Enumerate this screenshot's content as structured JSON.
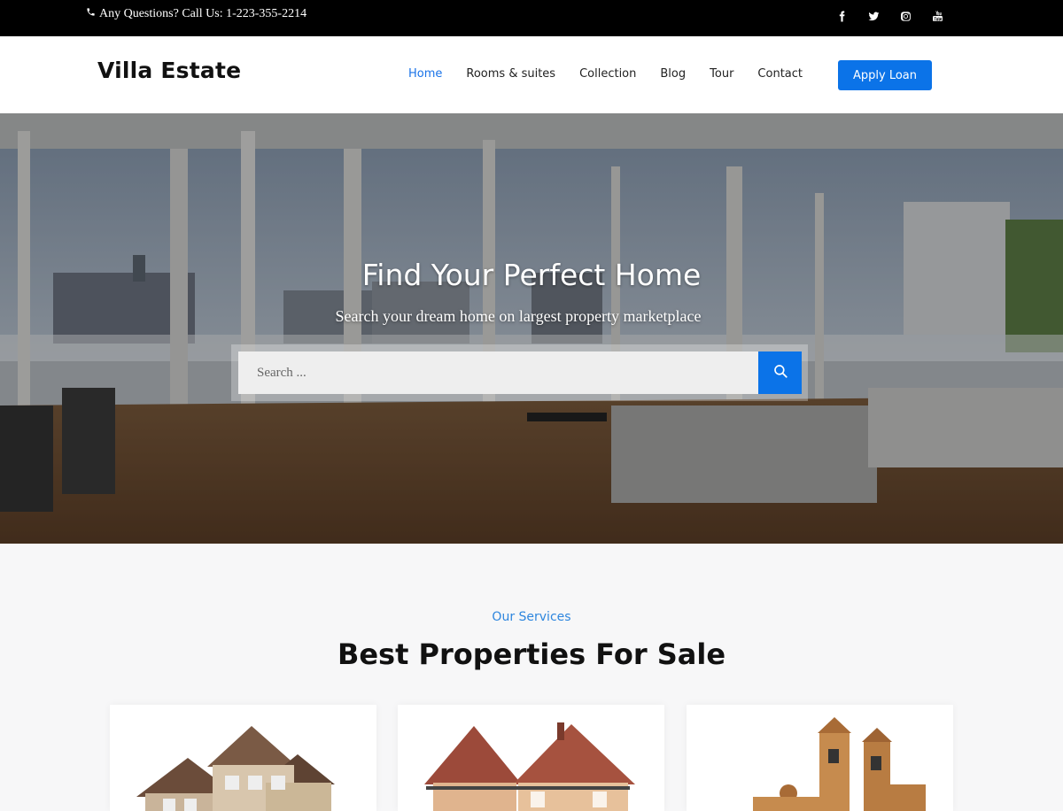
{
  "topbar": {
    "phone_text": "Any Questions? Call Us: 1-223-355-2214",
    "social_icons": [
      "facebook-icon",
      "twitter-icon",
      "instagram-icon",
      "youtube-icon"
    ]
  },
  "header": {
    "logo": "Villa Estate",
    "nav": [
      {
        "label": "Home",
        "active": true
      },
      {
        "label": "Rooms & suites",
        "active": false
      },
      {
        "label": "Collection",
        "active": false
      },
      {
        "label": "Blog",
        "active": false
      },
      {
        "label": "Tour",
        "active": false
      },
      {
        "label": "Contact",
        "active": false
      }
    ],
    "apply_label": "Apply Loan"
  },
  "hero": {
    "title": "Find Your Perfect Home",
    "subtitle": "Search your dream home on largest property marketplace",
    "search_placeholder": "Search ...",
    "search_icon": "search-icon"
  },
  "services": {
    "eyebrow": "Our Services",
    "title": "Best Properties For Sale"
  },
  "colors": {
    "accent": "#0b73e8",
    "topbar_bg": "#000000",
    "eyebrow": "#2e86de"
  }
}
